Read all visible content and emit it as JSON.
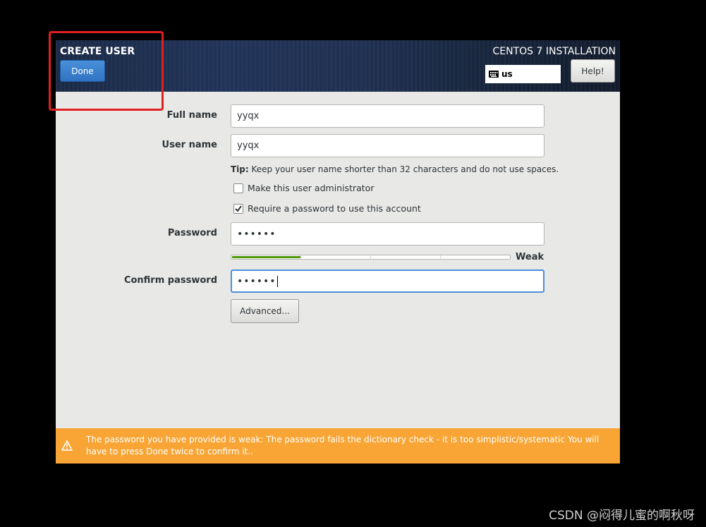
{
  "header": {
    "spoke_title": "CREATE USER",
    "done_label": "Done",
    "product_title": "CENTOS 7 INSTALLATION",
    "keyboard_layout": "us",
    "help_label": "Help!"
  },
  "form": {
    "full_name_label": "Full name",
    "full_name_value": "yyqx",
    "user_name_label": "User name",
    "user_name_value": "yyqx",
    "tip_prefix": "Tip:",
    "tip_text": " Keep your user name shorter than 32 characters and do not use spaces.",
    "admin_checkbox_label": "Make this user administrator",
    "admin_checked": false,
    "require_password_label": "Require a password to use this account",
    "require_password_checked": true,
    "password_label": "Password",
    "password_value": "••••••",
    "strength_label": "Weak",
    "strength_fraction": 0.25,
    "confirm_label": "Confirm password",
    "confirm_value": "••••••",
    "advanced_label": "Advanced..."
  },
  "warning": {
    "text": "The password you have provided is weak: The password fails the dictionary check - it is too simplistic/systematic You will have to press Done twice to confirm it.."
  },
  "watermark": "CSDN @闷得儿蜜的啊秋呀",
  "colors": {
    "accent_blue": "#4a90d9",
    "warning_orange": "#f8a535",
    "strength_green": "#4e9a06",
    "highlight_red": "#e02020"
  }
}
